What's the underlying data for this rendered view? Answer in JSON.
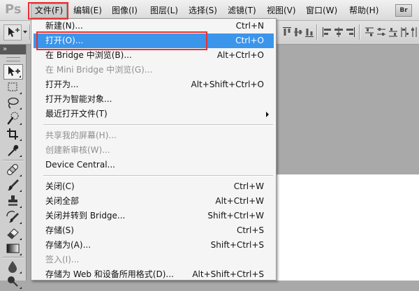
{
  "app": {
    "logo": "Ps",
    "bridge_button": "Br"
  },
  "menubar": {
    "active_index": 0,
    "items": [
      {
        "label": "文件(F)"
      },
      {
        "label": "编辑(E)"
      },
      {
        "label": "图像(I)"
      },
      {
        "label": "图层(L)"
      },
      {
        "label": "选择(S)"
      },
      {
        "label": "滤镜(T)"
      },
      {
        "label": "视图(V)"
      },
      {
        "label": "窗口(W)"
      },
      {
        "label": "帮助(H)"
      }
    ]
  },
  "file_menu": {
    "groups": [
      {
        "items": [
          {
            "label": "新建(N)...",
            "shortcut": "Ctrl+N",
            "enabled": true
          },
          {
            "label": "打开(O)...",
            "shortcut": "Ctrl+O",
            "enabled": true,
            "highlighted": true
          },
          {
            "label": "在 Bridge 中浏览(B)...",
            "shortcut": "Alt+Ctrl+O",
            "enabled": true
          },
          {
            "label": "在 Mini Bridge 中浏览(G)...",
            "enabled": false
          },
          {
            "label": "打开为...",
            "shortcut": "Alt+Shift+Ctrl+O",
            "enabled": true
          },
          {
            "label": "打开为智能对象...",
            "enabled": true
          },
          {
            "label": "最近打开文件(T)",
            "enabled": true,
            "has_submenu": true
          }
        ]
      },
      {
        "items": [
          {
            "label": "共享我的屏幕(H)...",
            "enabled": false
          },
          {
            "label": "创建新审核(W)...",
            "enabled": false
          },
          {
            "label": "Device Central...",
            "enabled": true
          }
        ]
      },
      {
        "items": [
          {
            "label": "关闭(C)",
            "shortcut": "Ctrl+W",
            "enabled": true
          },
          {
            "label": "关闭全部",
            "shortcut": "Alt+Ctrl+W",
            "enabled": true
          },
          {
            "label": "关闭并转到 Bridge...",
            "shortcut": "Shift+Ctrl+W",
            "enabled": true
          },
          {
            "label": "存储(S)",
            "shortcut": "Ctrl+S",
            "enabled": true
          },
          {
            "label": "存储为(A)...",
            "shortcut": "Shift+Ctrl+S",
            "enabled": true
          },
          {
            "label": "签入(I)...",
            "enabled": false
          },
          {
            "label": "存储为 Web 和设备所用格式(D)...",
            "shortcut": "Alt+Shift+Ctrl+S",
            "enabled": true
          }
        ]
      }
    ]
  },
  "toolbar": {
    "collapse_glyph": "»",
    "active_tool": "move-tool-icon",
    "tools": [
      "move-tool-icon",
      "marquee-tool-icon",
      "lasso-tool-icon",
      "quick-selection-tool-icon",
      "crop-tool-icon",
      "eyedropper-tool-icon",
      "spot-healing-tool-icon",
      "brush-tool-icon",
      "clone-stamp-tool-icon",
      "history-brush-tool-icon",
      "eraser-tool-icon",
      "gradient-tool-icon",
      "blur-tool-icon",
      "dodge-tool-icon"
    ]
  },
  "colors": {
    "menu_highlight": "#3a95eb",
    "annotation": "#e8312f",
    "menu_background": "#f5f5f5",
    "disabled_text": "#8e8e8e"
  }
}
